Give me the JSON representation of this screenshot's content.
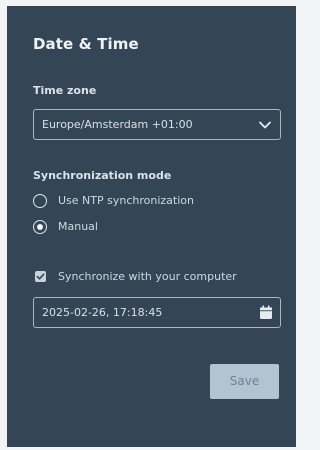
{
  "header": {
    "title": "Date & Time"
  },
  "timezone": {
    "label": "Time zone",
    "value": "Europe/Amsterdam +01:00"
  },
  "sync": {
    "label": "Synchronization mode",
    "options": [
      {
        "label": "Use NTP synchronization",
        "selected": false
      },
      {
        "label": "Manual",
        "selected": true
      }
    ]
  },
  "computer_sync": {
    "label": "Synchronize with your computer",
    "checked": true
  },
  "datetime": {
    "value": "2025-02-26, 17:18:45"
  },
  "actions": {
    "save_label": "Save"
  },
  "colors": {
    "panel": "#344556",
    "save_button": "#b3c3d2"
  },
  "icons": {
    "timezone_dropdown": "chevron-down-icon",
    "datetime_picker": "calendar-icon",
    "checkbox": "checkmark-icon"
  }
}
